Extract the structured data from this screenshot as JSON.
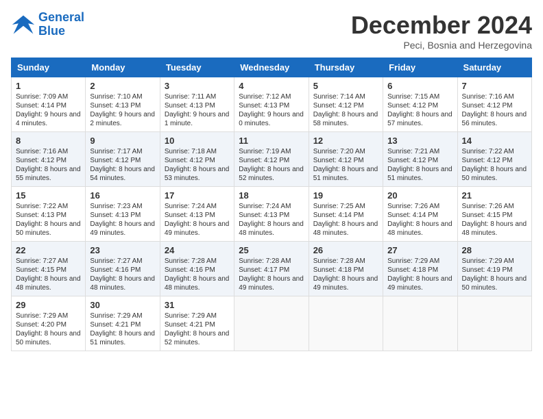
{
  "logo": {
    "line1": "General",
    "line2": "Blue"
  },
  "title": "December 2024",
  "subtitle": "Peci, Bosnia and Herzegovina",
  "days_header": [
    "Sunday",
    "Monday",
    "Tuesday",
    "Wednesday",
    "Thursday",
    "Friday",
    "Saturday"
  ],
  "weeks": [
    [
      {
        "day": "1",
        "info": "Sunrise: 7:09 AM\nSunset: 4:14 PM\nDaylight: 9 hours and 4 minutes."
      },
      {
        "day": "2",
        "info": "Sunrise: 7:10 AM\nSunset: 4:13 PM\nDaylight: 9 hours and 2 minutes."
      },
      {
        "day": "3",
        "info": "Sunrise: 7:11 AM\nSunset: 4:13 PM\nDaylight: 9 hours and 1 minute."
      },
      {
        "day": "4",
        "info": "Sunrise: 7:12 AM\nSunset: 4:13 PM\nDaylight: 9 hours and 0 minutes."
      },
      {
        "day": "5",
        "info": "Sunrise: 7:14 AM\nSunset: 4:12 PM\nDaylight: 8 hours and 58 minutes."
      },
      {
        "day": "6",
        "info": "Sunrise: 7:15 AM\nSunset: 4:12 PM\nDaylight: 8 hours and 57 minutes."
      },
      {
        "day": "7",
        "info": "Sunrise: 7:16 AM\nSunset: 4:12 PM\nDaylight: 8 hours and 56 minutes."
      }
    ],
    [
      {
        "day": "8",
        "info": "Sunrise: 7:16 AM\nSunset: 4:12 PM\nDaylight: 8 hours and 55 minutes."
      },
      {
        "day": "9",
        "info": "Sunrise: 7:17 AM\nSunset: 4:12 PM\nDaylight: 8 hours and 54 minutes."
      },
      {
        "day": "10",
        "info": "Sunrise: 7:18 AM\nSunset: 4:12 PM\nDaylight: 8 hours and 53 minutes."
      },
      {
        "day": "11",
        "info": "Sunrise: 7:19 AM\nSunset: 4:12 PM\nDaylight: 8 hours and 52 minutes."
      },
      {
        "day": "12",
        "info": "Sunrise: 7:20 AM\nSunset: 4:12 PM\nDaylight: 8 hours and 51 minutes."
      },
      {
        "day": "13",
        "info": "Sunrise: 7:21 AM\nSunset: 4:12 PM\nDaylight: 8 hours and 51 minutes."
      },
      {
        "day": "14",
        "info": "Sunrise: 7:22 AM\nSunset: 4:12 PM\nDaylight: 8 hours and 50 minutes."
      }
    ],
    [
      {
        "day": "15",
        "info": "Sunrise: 7:22 AM\nSunset: 4:13 PM\nDaylight: 8 hours and 50 minutes."
      },
      {
        "day": "16",
        "info": "Sunrise: 7:23 AM\nSunset: 4:13 PM\nDaylight: 8 hours and 49 minutes."
      },
      {
        "day": "17",
        "info": "Sunrise: 7:24 AM\nSunset: 4:13 PM\nDaylight: 8 hours and 49 minutes."
      },
      {
        "day": "18",
        "info": "Sunrise: 7:24 AM\nSunset: 4:13 PM\nDaylight: 8 hours and 48 minutes."
      },
      {
        "day": "19",
        "info": "Sunrise: 7:25 AM\nSunset: 4:14 PM\nDaylight: 8 hours and 48 minutes."
      },
      {
        "day": "20",
        "info": "Sunrise: 7:26 AM\nSunset: 4:14 PM\nDaylight: 8 hours and 48 minutes."
      },
      {
        "day": "21",
        "info": "Sunrise: 7:26 AM\nSunset: 4:15 PM\nDaylight: 8 hours and 48 minutes."
      }
    ],
    [
      {
        "day": "22",
        "info": "Sunrise: 7:27 AM\nSunset: 4:15 PM\nDaylight: 8 hours and 48 minutes."
      },
      {
        "day": "23",
        "info": "Sunrise: 7:27 AM\nSunset: 4:16 PM\nDaylight: 8 hours and 48 minutes."
      },
      {
        "day": "24",
        "info": "Sunrise: 7:28 AM\nSunset: 4:16 PM\nDaylight: 8 hours and 48 minutes."
      },
      {
        "day": "25",
        "info": "Sunrise: 7:28 AM\nSunset: 4:17 PM\nDaylight: 8 hours and 49 minutes."
      },
      {
        "day": "26",
        "info": "Sunrise: 7:28 AM\nSunset: 4:18 PM\nDaylight: 8 hours and 49 minutes."
      },
      {
        "day": "27",
        "info": "Sunrise: 7:29 AM\nSunset: 4:18 PM\nDaylight: 8 hours and 49 minutes."
      },
      {
        "day": "28",
        "info": "Sunrise: 7:29 AM\nSunset: 4:19 PM\nDaylight: 8 hours and 50 minutes."
      }
    ],
    [
      {
        "day": "29",
        "info": "Sunrise: 7:29 AM\nSunset: 4:20 PM\nDaylight: 8 hours and 50 minutes."
      },
      {
        "day": "30",
        "info": "Sunrise: 7:29 AM\nSunset: 4:21 PM\nDaylight: 8 hours and 51 minutes."
      },
      {
        "day": "31",
        "info": "Sunrise: 7:29 AM\nSunset: 4:21 PM\nDaylight: 8 hours and 52 minutes."
      },
      null,
      null,
      null,
      null
    ]
  ]
}
